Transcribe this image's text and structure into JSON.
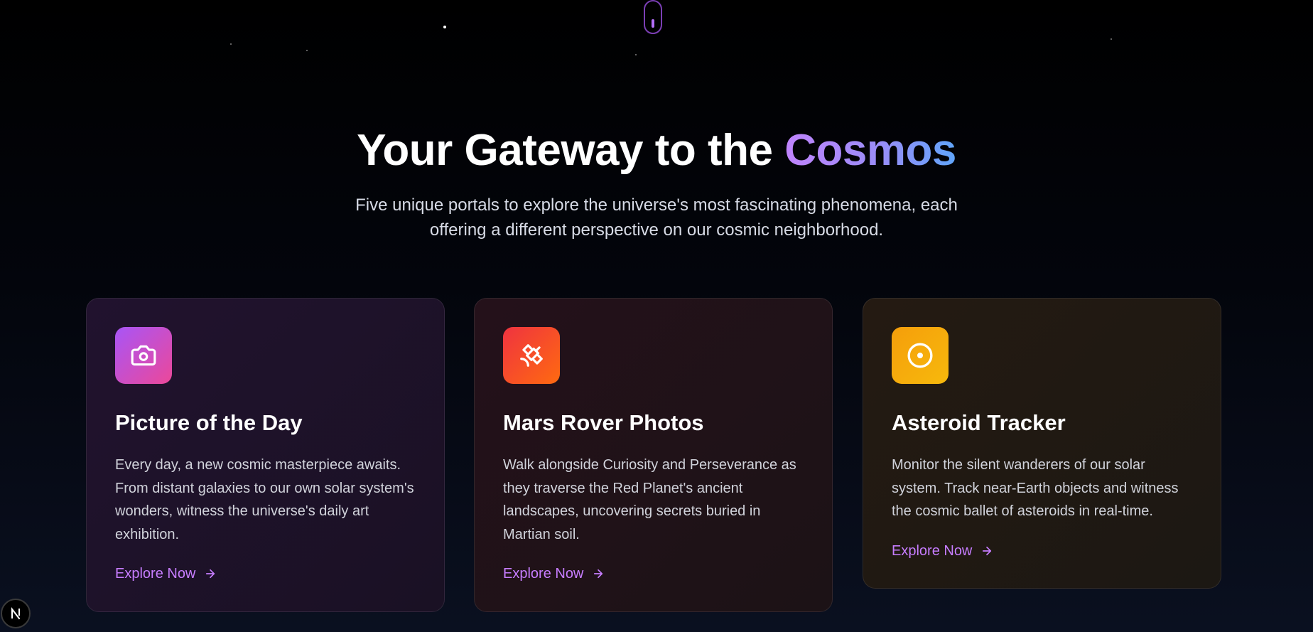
{
  "hero": {
    "title_prefix": "Your Gateway to the ",
    "title_accent": "Cosmos",
    "subtitle": "Five unique portals to explore the universe's most fascinating phenomena, each offering a different perspective on our cosmic neighborhood."
  },
  "cards": [
    {
      "icon": "camera-icon",
      "title": "Picture of the Day",
      "description": "Every day, a new cosmic masterpiece awaits. From distant galaxies to our own solar system's wonders, witness the universe's daily art exhibition.",
      "link_label": "Explore Now"
    },
    {
      "icon": "satellite-icon",
      "title": "Mars Rover Photos",
      "description": "Walk alongside Curiosity and Perseverance as they traverse the Red Planet's ancient landscapes, uncovering secrets buried in Martian soil.",
      "link_label": "Explore Now"
    },
    {
      "icon": "target-icon",
      "title": "Asteroid Tracker",
      "description": "Monitor the silent wanderers of our solar system. Track near-Earth objects and witness the cosmic ballet of asteroids in real-time.",
      "link_label": "Explore Now"
    }
  ],
  "badge": {
    "letter": "N"
  },
  "colors": {
    "link": "#c77dff",
    "accent_gradient_start": "#c084fc",
    "accent_gradient_end": "#60a5fa",
    "card1_icon": "#a855f7",
    "card2_icon": "#ef3340",
    "card3_icon": "#f59e0b"
  }
}
